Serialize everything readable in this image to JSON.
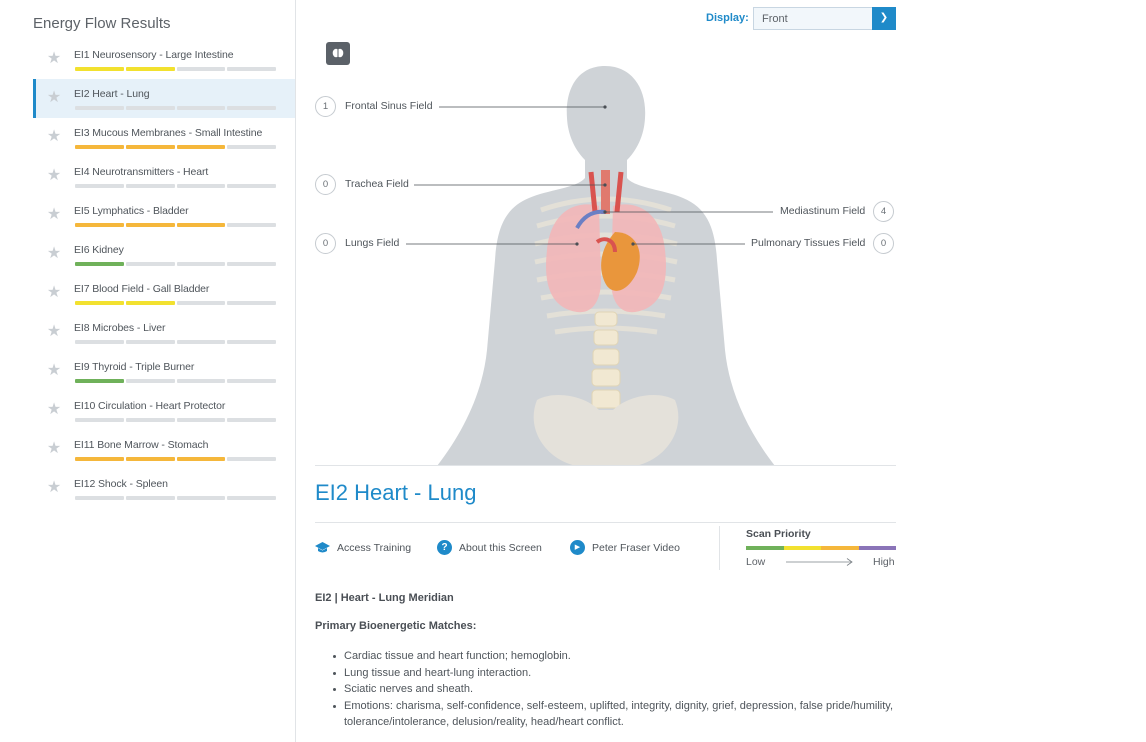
{
  "sidebar": {
    "title": "Energy Flow Results",
    "items": [
      {
        "label": "EI1 Neurosensory - Large Intestine",
        "bars": [
          "#f2e12f",
          "#f2e12f",
          "#dcdfe2",
          "#dcdfe2"
        ],
        "active": false
      },
      {
        "label": "EI2 Heart - Lung",
        "bars": [
          "#dcdfe2",
          "#dcdfe2",
          "#dcdfe2",
          "#dcdfe2"
        ],
        "active": true
      },
      {
        "label": "EI3 Mucous Membranes - Small Intestine",
        "bars": [
          "#f5b73b",
          "#f5b73b",
          "#f5b73b",
          "#dcdfe2"
        ],
        "active": false
      },
      {
        "label": "EI4 Neurotransmitters - Heart",
        "bars": [
          "#dcdfe2",
          "#dcdfe2",
          "#dcdfe2",
          "#dcdfe2"
        ],
        "active": false
      },
      {
        "label": "EI5 Lymphatics - Bladder",
        "bars": [
          "#f5b73b",
          "#f5b73b",
          "#f5b73b",
          "#dcdfe2"
        ],
        "active": false
      },
      {
        "label": "EI6 Kidney",
        "bars": [
          "#6fb15a",
          "#dcdfe2",
          "#dcdfe2",
          "#dcdfe2"
        ],
        "active": false
      },
      {
        "label": "EI7 Blood Field - Gall Bladder",
        "bars": [
          "#f2e12f",
          "#f2e12f",
          "#dcdfe2",
          "#dcdfe2"
        ],
        "active": false
      },
      {
        "label": "EI8 Microbes - Liver",
        "bars": [
          "#dcdfe2",
          "#dcdfe2",
          "#dcdfe2",
          "#dcdfe2"
        ],
        "active": false
      },
      {
        "label": "EI9 Thyroid - Triple Burner",
        "bars": [
          "#6fb15a",
          "#dcdfe2",
          "#dcdfe2",
          "#dcdfe2"
        ],
        "active": false
      },
      {
        "label": "EI10 Circulation - Heart Protector",
        "bars": [
          "#dcdfe2",
          "#dcdfe2",
          "#dcdfe2",
          "#dcdfe2"
        ],
        "active": false
      },
      {
        "label": "EI11 Bone Marrow - Stomach",
        "bars": [
          "#f5b73b",
          "#f5b73b",
          "#f5b73b",
          "#dcdfe2"
        ],
        "active": false
      },
      {
        "label": "EI12 Shock - Spleen",
        "bars": [
          "#dcdfe2",
          "#dcdfe2",
          "#dcdfe2",
          "#dcdfe2"
        ],
        "active": false
      }
    ]
  },
  "display": {
    "label": "Display:",
    "value": "Front"
  },
  "fields": {
    "frontal_sinus": {
      "count": "1",
      "name": "Frontal Sinus Field"
    },
    "trachea": {
      "count": "0",
      "name": "Trachea Field"
    },
    "mediastinum": {
      "count": "4",
      "name": "Mediastinum Field"
    },
    "lungs": {
      "count": "0",
      "name": "Lungs Field"
    },
    "pulmonary": {
      "count": "0",
      "name": "Pulmonary Tissues Field"
    }
  },
  "section_title": "EI2 Heart - Lung",
  "links": {
    "training": "Access Training",
    "about": "About this Screen",
    "video": "Peter Fraser Video"
  },
  "scan_priority": {
    "title": "Scan Priority",
    "low": "Low",
    "high": "High",
    "colors": [
      "#6fb15a",
      "#f2e12f",
      "#f5b73b",
      "#8a74b8"
    ]
  },
  "description": {
    "heading": "EI2 | Heart - Lung Meridian",
    "subheading": "Primary Bioenergetic Matches:",
    "items": [
      "Cardiac tissue and heart function; hemoglobin.",
      "Lung tissue and heart-lung interaction.",
      "Sciatic nerves and sheath.",
      "Emotions: charisma, self-confidence, self-esteem, uplifted, integrity, dignity, grief, depression, false pride/humility, tolerance/intolerance, delusion/reality, head/heart conflict."
    ]
  },
  "colors": {
    "accent": "#1f8ac9",
    "active_bg": "#e6f1f9"
  }
}
